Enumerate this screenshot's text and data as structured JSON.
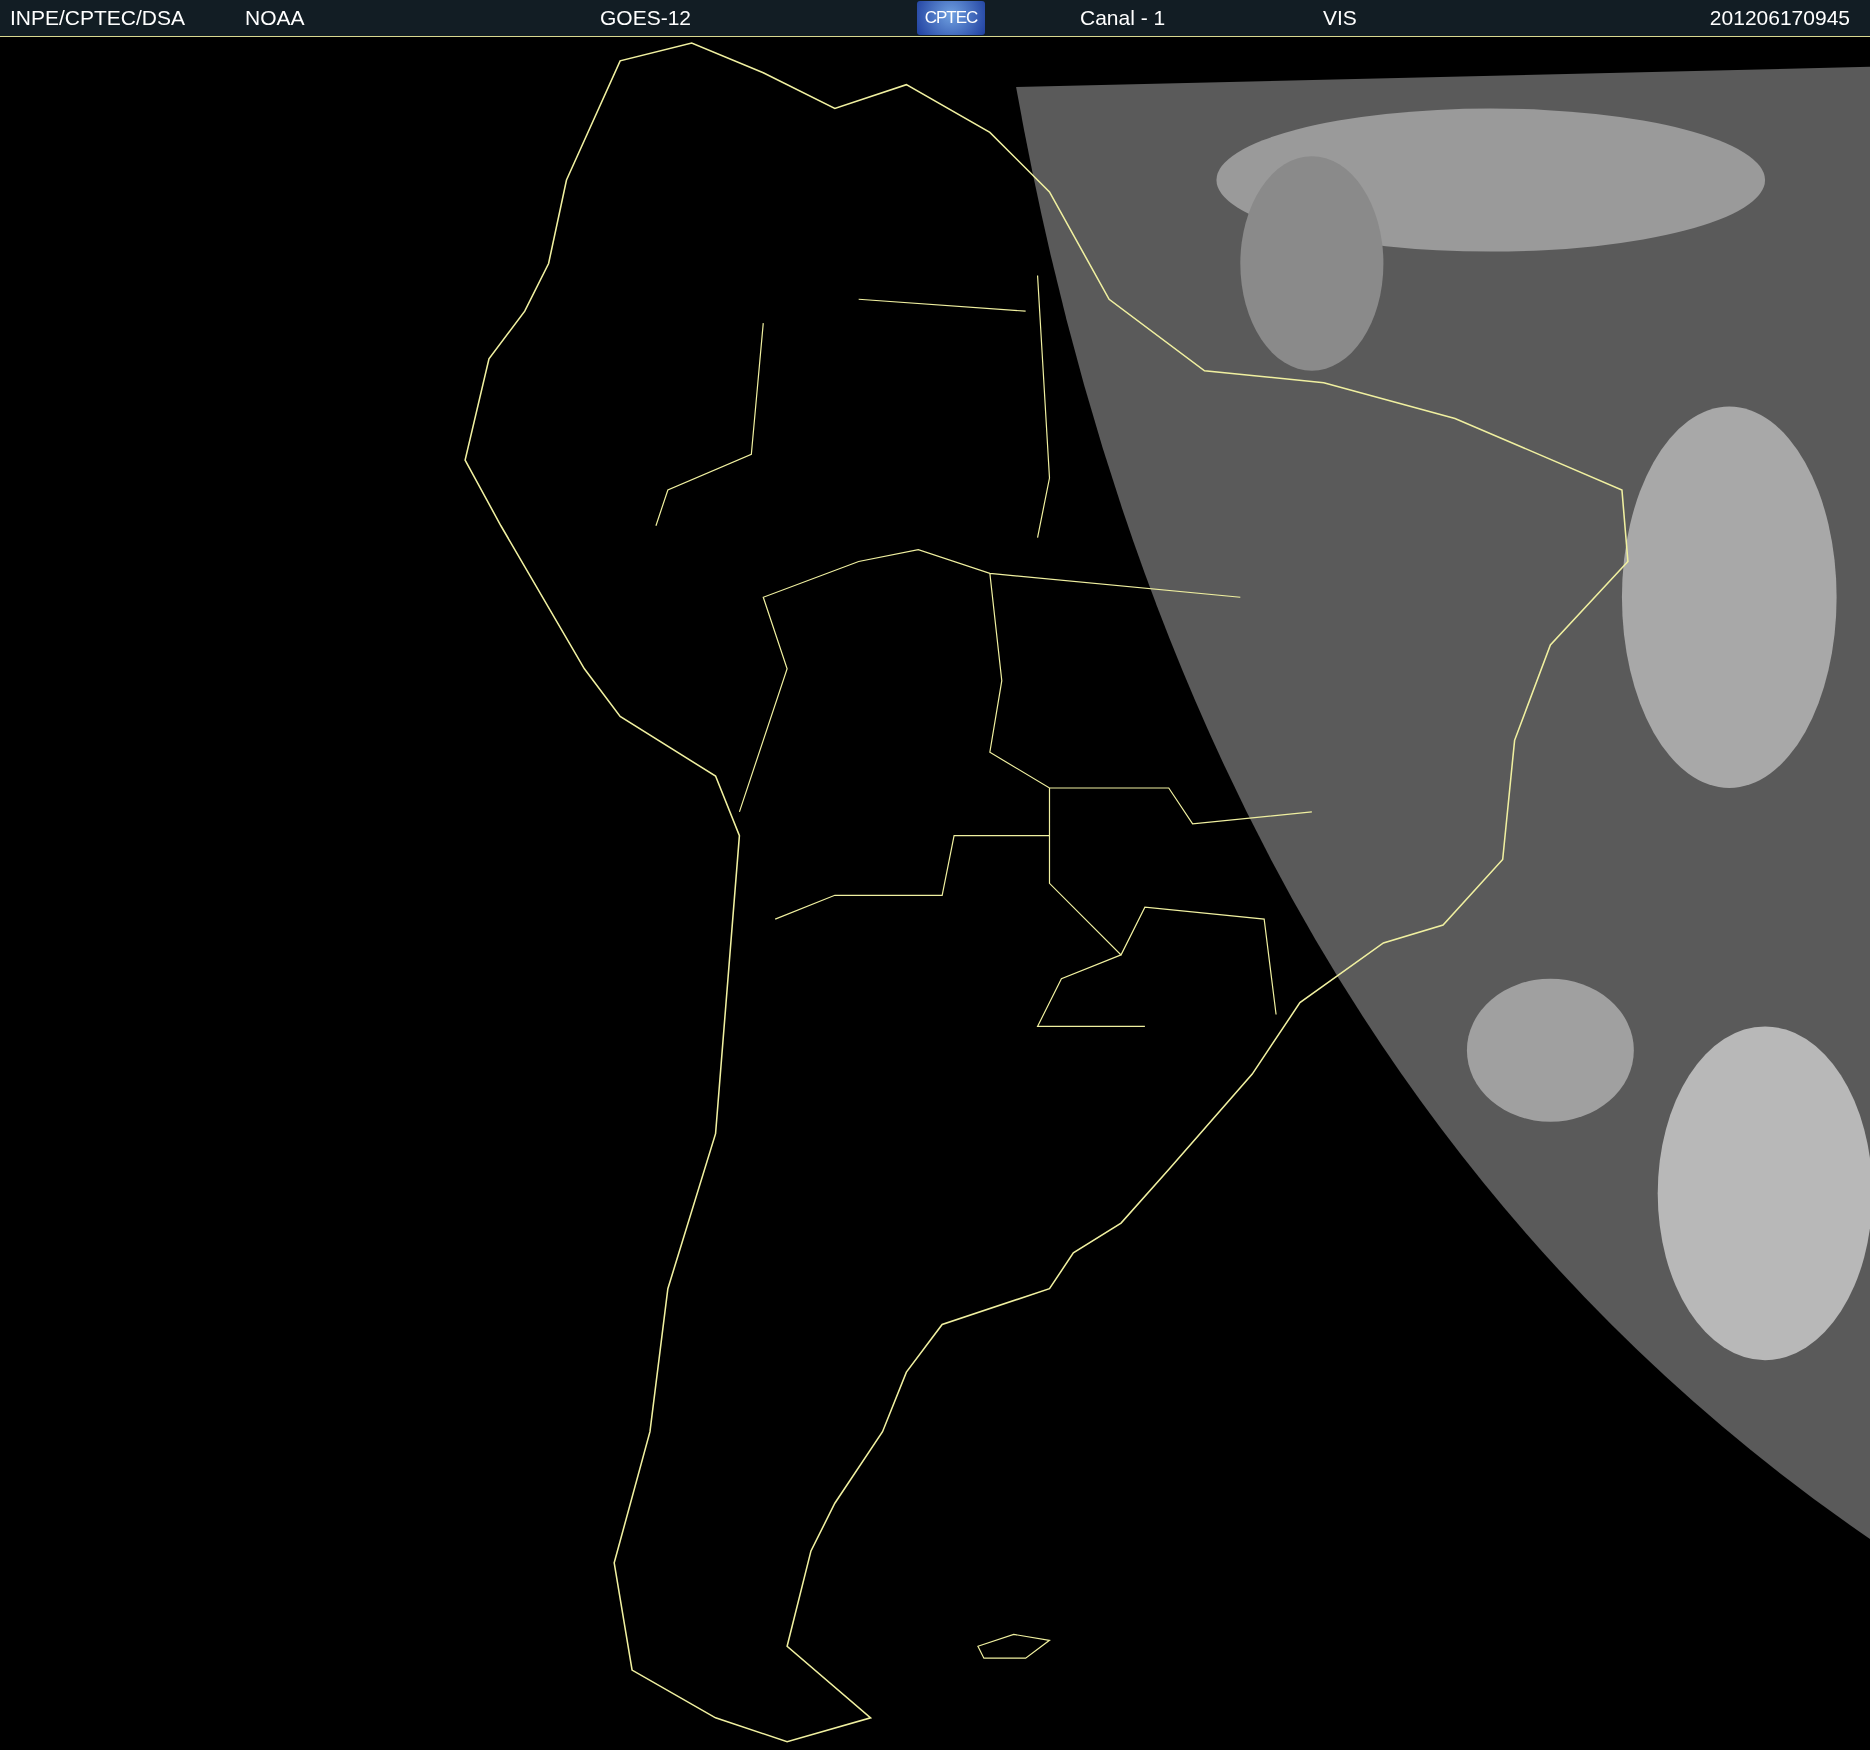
{
  "header": {
    "items": [
      {
        "kind": "text",
        "text": "INPE/CPTEC/DSA"
      },
      {
        "kind": "text",
        "text": "NOAA"
      },
      {
        "kind": "text",
        "text": "GOES-12"
      },
      {
        "kind": "logo",
        "text": "CPTEC"
      },
      {
        "kind": "text",
        "text": "Canal - 1"
      },
      {
        "kind": "text",
        "text": "VIS"
      },
      {
        "kind": "text",
        "text": "201206170945"
      }
    ]
  }
}
